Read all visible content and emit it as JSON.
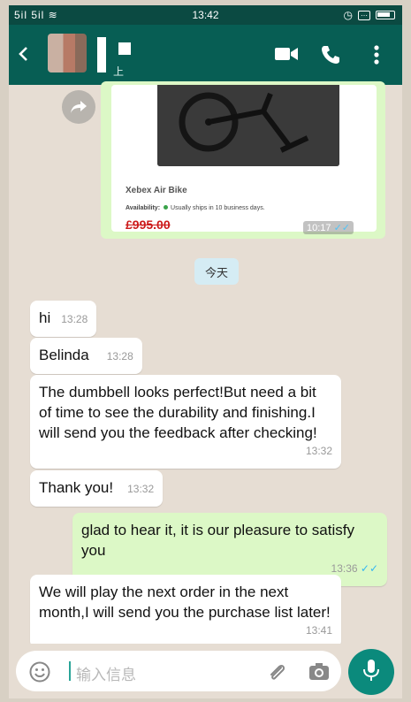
{
  "status_bar": {
    "signal": "5il 5il ≋",
    "time": "13:42"
  },
  "header": {
    "contact_status": "上"
  },
  "product_card": {
    "name": "Xebex Air Bike",
    "availability_label": "Availability:",
    "availability_text": "Usually ships in 10 business days.",
    "price": "£995.00",
    "time": "10:17",
    "ticks": "✓✓"
  },
  "date_chip": "今天",
  "messages": [
    {
      "text": "hi",
      "time": "13:28"
    },
    {
      "text": "Belinda",
      "time": "13:28"
    },
    {
      "text": "The dumbbell looks perfect!But need a bit of time to see the durability and finishing.I will send you the feedback after checking!",
      "time": "13:32"
    },
    {
      "text": "Thank you!",
      "time": "13:32"
    },
    {
      "text": "glad to hear it, it is our pleasure to satisfy you",
      "time": "13:36",
      "ticks": "✓✓"
    },
    {
      "text": "We will play the next order in the next month,I will send you the purchase list later!",
      "time": "13:41"
    }
  ],
  "composer": {
    "placeholder": "输入信息"
  },
  "colors": {
    "header": "#075e54",
    "outgoing_bubble": "#dcf8c6",
    "incoming_bubble": "#ffffff",
    "accent": "#0b8a7c"
  },
  "icons": [
    "back-arrow-icon",
    "video-call-icon",
    "phone-icon",
    "more-vert-icon",
    "forward-icon",
    "emoji-icon",
    "attach-icon",
    "camera-icon",
    "mic-icon"
  ]
}
